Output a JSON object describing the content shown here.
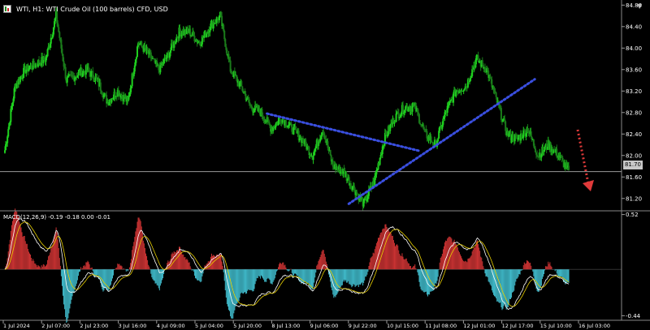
{
  "header": {
    "title": "WTI, H1:  WTI Crude Oil (100 barrels) CFD, USD",
    "icon": "chart-symbol-icon"
  },
  "current_price": "81.70",
  "macd": {
    "label": "MACD(12,26,9) -0.19 -0.18 0.00 -0.01"
  },
  "colors": {
    "background": "#000000",
    "bull": "#1fd11f",
    "bear": "#1a7a1a",
    "trendline": "#3a4fe0",
    "forecast_arrow": "#e03a3a",
    "histogram_pos": "#c83232",
    "histogram_neg": "#3fb8c8",
    "macd_line": "#ffffff",
    "signal_line": "#e8d000"
  },
  "chart_data": {
    "type": "candlestick",
    "symbol": "WTI",
    "timeframe": "H1",
    "title": "WTI, H1:  WTI Crude Oil (100 barrels) CFD, USD",
    "price_axis": {
      "ticks": [
        "84.80",
        "84.40",
        "84.00",
        "83.60",
        "83.20",
        "82.80",
        "82.40",
        "82.00",
        "81.60",
        "81.20"
      ],
      "range": [
        81.0,
        84.85
      ]
    },
    "time_axis": {
      "ticks": [
        "1 Jul 2024",
        "2 Jul 07:00",
        "2 Jul 23:00",
        "3 Jul 16:00",
        "4 Jul 09:00",
        "5 Jul 04:00",
        "5 Jul 20:00",
        "8 Jul 13:00",
        "9 Jul 06:00",
        "9 Jul 22:00",
        "10 Jul 15:00",
        "11 Jul 08:00",
        "12 Jul 01:00",
        "12 Jul 17:00",
        "15 Jul 10:00",
        "16 Jul 03:00"
      ]
    },
    "current_price": 81.7,
    "price_path": [
      [
        0,
        82.1
      ],
      [
        3,
        83.3
      ],
      [
        6,
        83.6
      ],
      [
        9,
        83.7
      ],
      [
        12,
        83.8
      ],
      [
        15,
        84.6
      ],
      [
        18,
        83.4
      ],
      [
        21,
        83.5
      ],
      [
        24,
        83.6
      ],
      [
        27,
        83.4
      ],
      [
        30,
        83.0
      ],
      [
        33,
        83.2
      ],
      [
        36,
        83.0
      ],
      [
        39,
        84.1
      ],
      [
        42,
        83.9
      ],
      [
        45,
        83.6
      ],
      [
        48,
        83.9
      ],
      [
        51,
        84.3
      ],
      [
        54,
        84.3
      ],
      [
        57,
        84.1
      ],
      [
        60,
        84.4
      ],
      [
        63,
        84.6
      ],
      [
        66,
        83.6
      ],
      [
        69,
        83.3
      ],
      [
        72,
        82.9
      ],
      [
        75,
        82.8
      ],
      [
        78,
        82.5
      ],
      [
        81,
        82.7
      ],
      [
        84,
        82.5
      ],
      [
        87,
        82.3
      ],
      [
        90,
        82.0
      ],
      [
        93,
        82.5
      ],
      [
        96,
        81.8
      ],
      [
        99,
        81.7
      ],
      [
        102,
        81.4
      ],
      [
        105,
        81.1
      ],
      [
        108,
        81.5
      ],
      [
        111,
        82.3
      ],
      [
        114,
        82.7
      ],
      [
        117,
        82.9
      ],
      [
        120,
        82.9
      ],
      [
        123,
        82.4
      ],
      [
        126,
        82.2
      ],
      [
        129,
        82.8
      ],
      [
        132,
        83.2
      ],
      [
        135,
        83.3
      ],
      [
        138,
        83.8
      ],
      [
        141,
        83.6
      ],
      [
        144,
        83.0
      ],
      [
        147,
        82.4
      ],
      [
        150,
        82.3
      ],
      [
        153,
        82.5
      ],
      [
        156,
        82.0
      ],
      [
        159,
        82.2
      ],
      [
        162,
        82.0
      ],
      [
        165,
        81.7
      ]
    ],
    "candle_spacing_px": 3.5,
    "annotations": [
      {
        "type": "trendline",
        "style": "dotted",
        "from": [
          0.428,
          82.78
        ],
        "to": [
          0.676,
          82.08
        ]
      },
      {
        "type": "trendline",
        "style": "dotted",
        "from": [
          0.56,
          81.1
        ],
        "to": [
          0.86,
          83.42
        ]
      },
      {
        "type": "arrow",
        "direction": "down",
        "style": "dotted"
      }
    ],
    "indicator": {
      "name": "MACD(12,26,9)",
      "axis_ticks": [
        "0.52",
        "-0.44"
      ],
      "range": [
        -0.46,
        0.54
      ],
      "values_shown": [
        -0.19,
        -0.18,
        0.0,
        -0.01
      ]
    }
  }
}
